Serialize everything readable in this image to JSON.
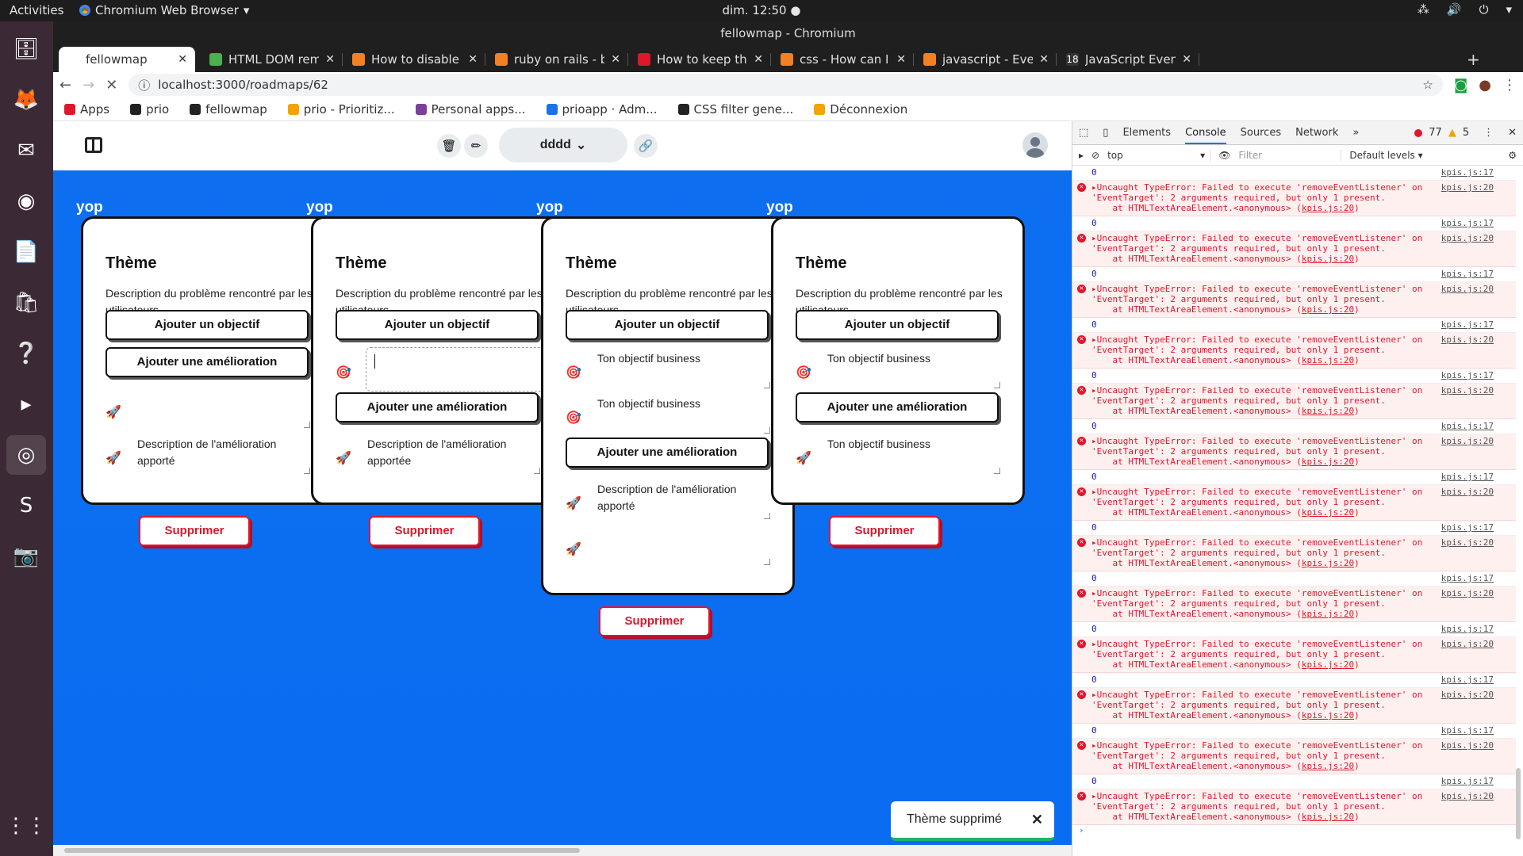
{
  "os": {
    "activities": "Activities",
    "app_menu": "Chromium Web Browser",
    "clock": "dim. 12:50"
  },
  "window": {
    "title": "fellowmap - Chromium",
    "tabs": [
      {
        "title": "fellowmap",
        "icon_color": "#ffffff",
        "active": true
      },
      {
        "title": "HTML DOM removeEve",
        "icon_color": "#4caf50"
      },
      {
        "title": "How to disable repetit",
        "icon_color": "#f48024"
      },
      {
        "title": "ruby on rails - button_t",
        "icon_color": "#f48024"
      },
      {
        "title": "How to keep the Scroll",
        "icon_color": "#e0162b"
      },
      {
        "title": "css - How can I make th",
        "icon_color": "#f48024"
      },
      {
        "title": "javascript - EventListen",
        "icon_color": "#f48024"
      },
      {
        "title": "JavaScript Event KeyCo",
        "icon_color": "#333333",
        "icon_text": "18"
      }
    ],
    "url": "localhost:3000/roadmaps/62",
    "bookmarks": [
      {
        "label": "Apps",
        "color": "#e0162b"
      },
      {
        "label": "prio",
        "color": "#222222"
      },
      {
        "label": "fellowmap",
        "color": "#222222"
      },
      {
        "label": "prio - Prioritiz...",
        "color": "#f4a300"
      },
      {
        "label": "Personal apps...",
        "color": "#7b3fa0"
      },
      {
        "label": "prioapp · Adm...",
        "color": "#1a73e8"
      },
      {
        "label": "CSS filter gene...",
        "color": "#222222"
      },
      {
        "label": "Déconnexion",
        "color": "#f4a300"
      }
    ]
  },
  "app": {
    "roadmap_name": "dddd",
    "columns": [
      {
        "title": "yop",
        "theme": "Thème",
        "description": "Description du problème rencontré par les utilisateurs",
        "add_objective": "Ajouter un objectif",
        "add_improvement": "Ajouter une amélioration",
        "improvements": [
          "",
          "Description de l'amélioration apporté"
        ],
        "delete": "Supprimer"
      },
      {
        "title": "yop",
        "theme": "Thème",
        "description": "Description du problème rencontré par les utilisateurs",
        "add_objective": "Ajouter un objectif",
        "add_improvement": "Ajouter une amélioration",
        "improvements": [
          "Description de l'amélioration apportée"
        ],
        "delete": "Supprimer"
      },
      {
        "title": "yop",
        "theme": "Thème",
        "description": "Description du problème rencontré par les utilisateurs",
        "add_objective": "Ajouter un objectif",
        "objectives": [
          "Ton objectif business",
          "Ton objectif business"
        ],
        "add_improvement": "Ajouter une amélioration",
        "improvements": [
          "Description de l'amélioration apporté",
          ""
        ],
        "delete": "Supprimer"
      },
      {
        "title": "yop",
        "theme": "Thème",
        "description": "Description du problème rencontré par les utilisateurs",
        "add_objective": "Ajouter un objectif",
        "objectives": [
          "Ton objectif business"
        ],
        "add_improvement": "Ajouter une amélioration",
        "improvements": [
          "Ton objectif business"
        ],
        "delete": "Supprimer"
      }
    ],
    "toast": "Thème supprimé"
  },
  "devtools": {
    "tabs": [
      "Elements",
      "Console",
      "Sources",
      "Network"
    ],
    "error_count": "77",
    "warning_count": "5",
    "context": "top",
    "filter_placeholder": "Filter",
    "levels": "Default levels",
    "log_value": "0",
    "log_source": "kpis.js:17",
    "error_source": "kpis.js:20",
    "error_line1": "Uncaught TypeError: Failed to execute 'removeEventListener' on",
    "error_line2": "'EventTarget': 2 arguments required, but only 1 present.",
    "error_line3": "at HTMLTextAreaElement.<anonymous> (",
    "error_count_rows": 13
  }
}
